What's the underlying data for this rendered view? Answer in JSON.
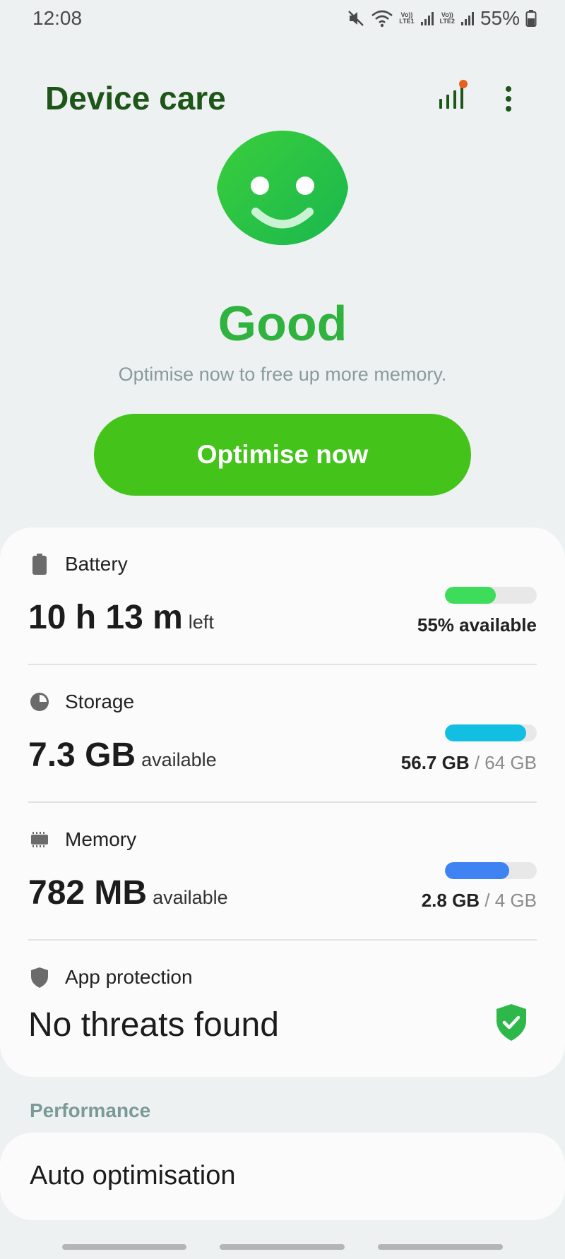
{
  "status_bar": {
    "time": "12:08",
    "sim1": [
      "Vo))",
      "LTE1"
    ],
    "sim2": [
      "Vo))",
      "LTE2"
    ],
    "battery": "55%"
  },
  "app_bar": {
    "title": "Device care",
    "icons": [
      "diagnostics-signal-icon",
      "more-options-icon"
    ]
  },
  "overview": {
    "status": "Good",
    "hint": "Optimise now to free up more memory.",
    "button": "Optimise now"
  },
  "items": {
    "battery": {
      "label": "Battery",
      "value": "10 h 13 m",
      "suffix": "left",
      "level_percent": 55,
      "caption": "55% available",
      "color": "#3ddc5a"
    },
    "storage": {
      "label": "Storage",
      "value": "7.3 GB",
      "suffix": "available",
      "used": "56.7 GB",
      "total": "64 GB",
      "separator": " / ",
      "fill_fraction": 0.886,
      "color": "#12bfe2"
    },
    "memory": {
      "label": "Memory",
      "value": "782 MB",
      "suffix": "available",
      "used": "2.8 GB",
      "total": "4 GB",
      "separator": " / ",
      "fill_fraction": 0.7,
      "color": "#3f82f2"
    },
    "app_protection": {
      "label": "App protection",
      "value": "No threats found",
      "icon": "shield-check-icon",
      "color": "#2fb84a"
    }
  },
  "performance": {
    "section_title": "Performance",
    "auto_optimisation": "Auto optimisation"
  },
  "colors": {
    "accent": "#44c31a",
    "title": "#1e5518",
    "status_good": "#2fb33e"
  }
}
